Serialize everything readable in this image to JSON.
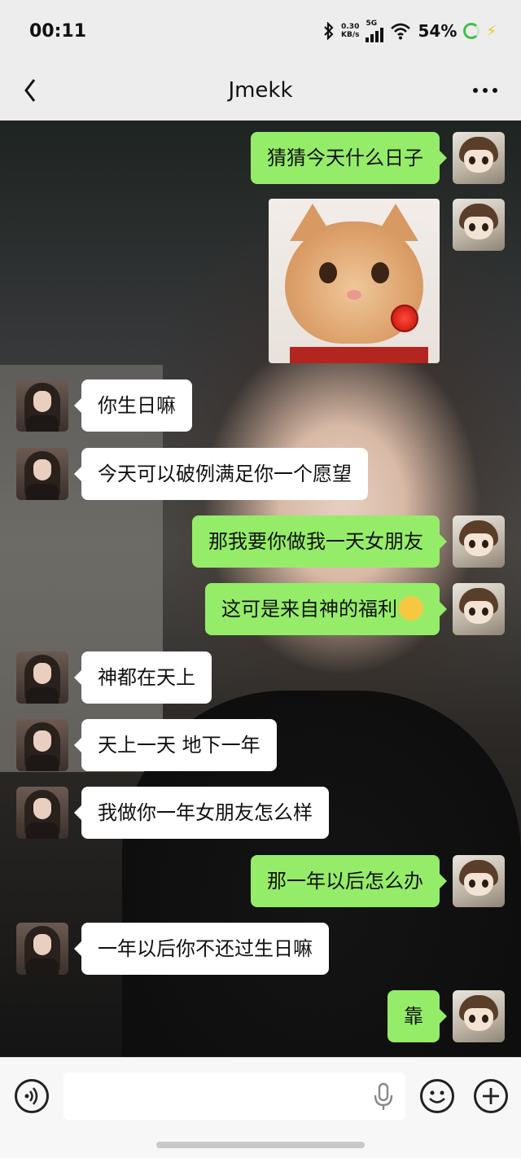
{
  "status_bar": {
    "time": "00:11",
    "net_speed_value": "0.30",
    "net_speed_unit": "KB/s",
    "network": "5G",
    "battery": "54%"
  },
  "nav": {
    "title": "Jmekk"
  },
  "messages": [
    {
      "side": "right",
      "type": "text",
      "text": "猜猜今天什么日子"
    },
    {
      "side": "right",
      "type": "sticker",
      "icon": "cat-with-rose-sticker"
    },
    {
      "side": "left",
      "type": "text",
      "text": "你生日嘛"
    },
    {
      "side": "left",
      "type": "text",
      "text": "今天可以破例满足你一个愿望"
    },
    {
      "side": "right",
      "type": "text",
      "text": "那我要你做我一天女朋友"
    },
    {
      "side": "right",
      "type": "text",
      "text": "这可是来自神的福利",
      "emoji": "smirk-emoji"
    },
    {
      "side": "left",
      "type": "text",
      "text": "神都在天上"
    },
    {
      "side": "left",
      "type": "text",
      "text": "天上一天 地下一年"
    },
    {
      "side": "left",
      "type": "text",
      "text": "我做你一年女朋友怎么样"
    },
    {
      "side": "right",
      "type": "text",
      "text": "那一年以后怎么办"
    },
    {
      "side": "left",
      "type": "text",
      "text": "一年以后你不还过生日嘛"
    },
    {
      "side": "right",
      "type": "text",
      "text": "靠"
    }
  ],
  "colors": {
    "my_bubble": "#95ec69",
    "their_bubble": "#ffffff",
    "chrome": "#ededed"
  }
}
